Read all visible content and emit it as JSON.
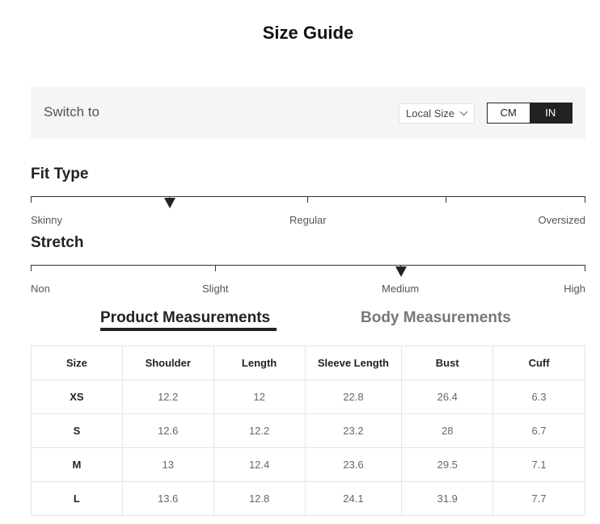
{
  "title": "Size Guide",
  "switch": {
    "label": "Switch to",
    "local_size": "Local Size",
    "units": [
      "CM",
      "IN"
    ],
    "active_unit": "IN"
  },
  "fit_type": {
    "title": "Fit Type",
    "labels": [
      "Skinny",
      "Regular",
      "Oversized"
    ],
    "level": 0.25
  },
  "stretch": {
    "title": "Stretch",
    "labels": [
      "Non",
      "Slight",
      "Medium",
      "High"
    ],
    "level": 0.667
  },
  "tabs": {
    "product": "Product Measurements",
    "body": "Body Measurements",
    "active": "product"
  },
  "table": {
    "headers": [
      "Size",
      "Shoulder",
      "Length",
      "Sleeve Length",
      "Bust",
      "Cuff"
    ],
    "rows": [
      [
        "XS",
        "12.2",
        "12",
        "22.8",
        "26.4",
        "6.3"
      ],
      [
        "S",
        "12.6",
        "12.2",
        "23.2",
        "28",
        "6.7"
      ],
      [
        "M",
        "13",
        "12.4",
        "23.6",
        "29.5",
        "7.1"
      ],
      [
        "L",
        "13.6",
        "12.8",
        "24.1",
        "31.9",
        "7.7"
      ]
    ]
  }
}
